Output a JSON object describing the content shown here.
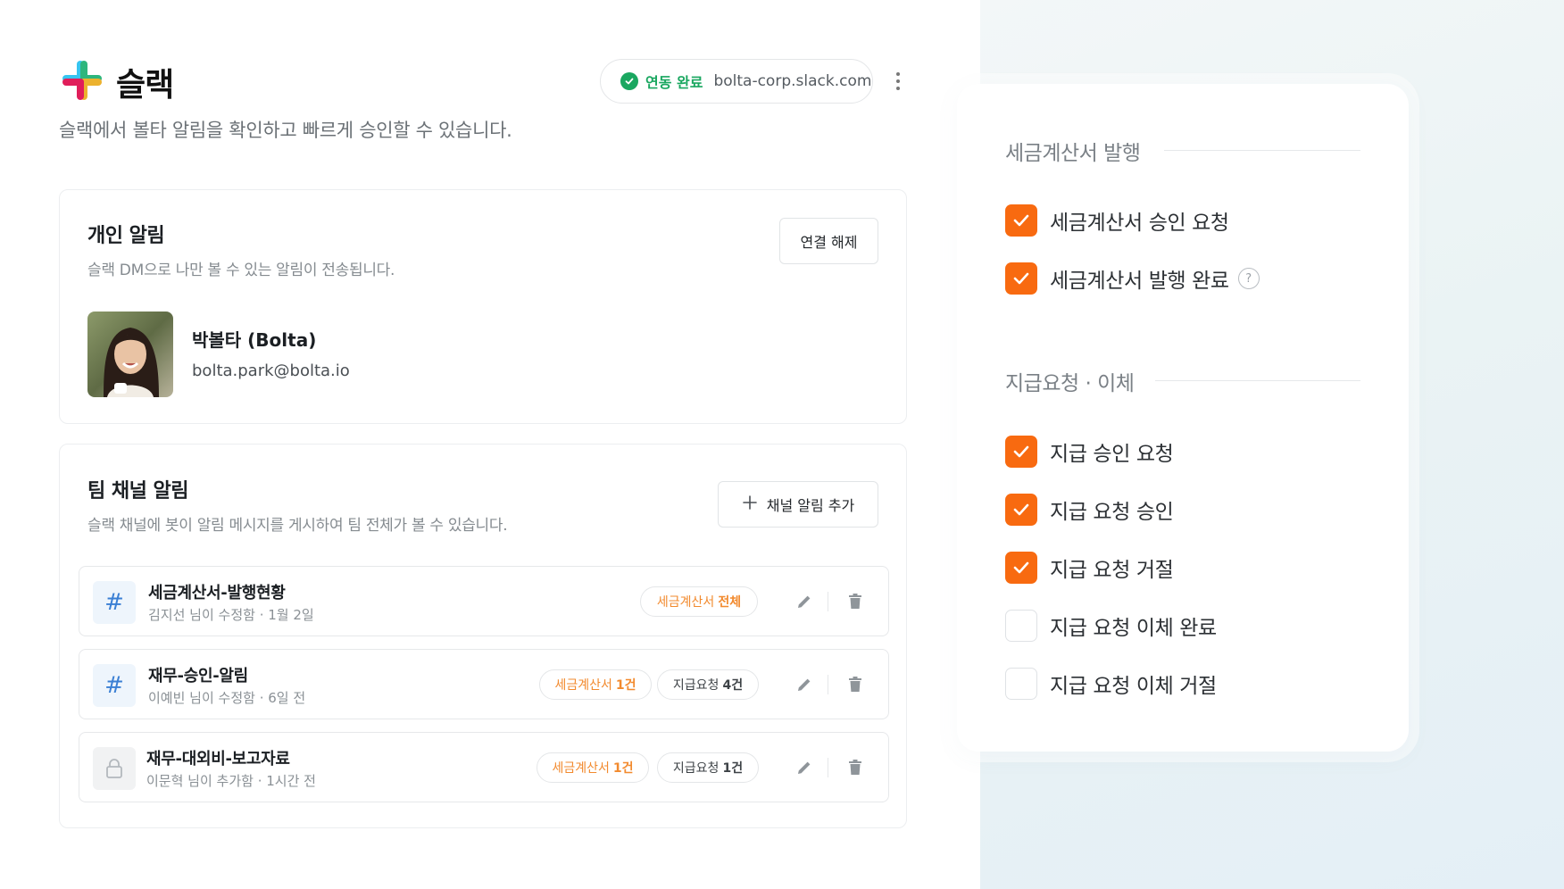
{
  "header": {
    "app_title": "슬랙",
    "subtitle": "슬랙에서 볼타 알림을 확인하고 빠르게 승인할 수 있습니다.",
    "status_label": "연동 완료",
    "status_domain": "bolta-corp.slack.com",
    "more_icon": "more-vertical-icon"
  },
  "personal": {
    "title": "개인 알림",
    "desc": "슬랙 DM으로 나만 볼 수 있는 알림이 전송됩니다.",
    "disconnect_label": "연결 해제",
    "user_name": "박볼타 (Bolta)",
    "user_email": "bolta.park@bolta.io"
  },
  "team": {
    "title": "팀 채널 알림",
    "desc": "슬랙 채널에 봇이 알림 메시지를 게시하여 팀 전체가 볼 수 있습니다.",
    "add_label": "채널 알림 추가",
    "channels": [
      {
        "icon": "hash-icon",
        "name": "세금계산서-발행현황",
        "meta": "김지선 님이 수정함 · 1월 2일",
        "tags": [
          {
            "label": "세금계산서",
            "count": "전체",
            "color": "orange"
          }
        ]
      },
      {
        "icon": "hash-icon",
        "name": "재무-승인-알림",
        "meta": "이예빈 님이 수정함 · 6일 전",
        "tags": [
          {
            "label": "세금계산서",
            "count": "1건",
            "color": "orange"
          },
          {
            "label": "지급요청",
            "count": "4건",
            "color": "gray"
          }
        ]
      },
      {
        "icon": "lock-icon",
        "name": "재무-대외비-보고자료",
        "meta": "이문혁 님이 추가함 · 1시간 전",
        "tags": [
          {
            "label": "세금계산서",
            "count": "1건",
            "color": "orange"
          },
          {
            "label": "지급요청",
            "count": "1건",
            "color": "gray"
          }
        ]
      }
    ]
  },
  "settings": {
    "sections": [
      {
        "title": "세금계산서 발행",
        "items": [
          {
            "label": "세금계산서 승인 요청",
            "checked": true
          },
          {
            "label": "세금계산서 발행 완료",
            "checked": true,
            "help": "?"
          }
        ]
      },
      {
        "title": "지급요청 · 이체",
        "items": [
          {
            "label": "지급 승인 요청",
            "checked": true
          },
          {
            "label": "지급 요청 승인",
            "checked": true
          },
          {
            "label": "지급 요청 거절",
            "checked": true
          },
          {
            "label": "지급 요청 이체 완료",
            "checked": false
          },
          {
            "label": "지급 요청 이체 거절",
            "checked": false
          }
        ]
      }
    ]
  },
  "colors": {
    "accent_orange": "#f86a10",
    "tag_orange": "#f28a2e",
    "success_green": "#1aa760",
    "hash_blue": "#3a7fd4"
  }
}
